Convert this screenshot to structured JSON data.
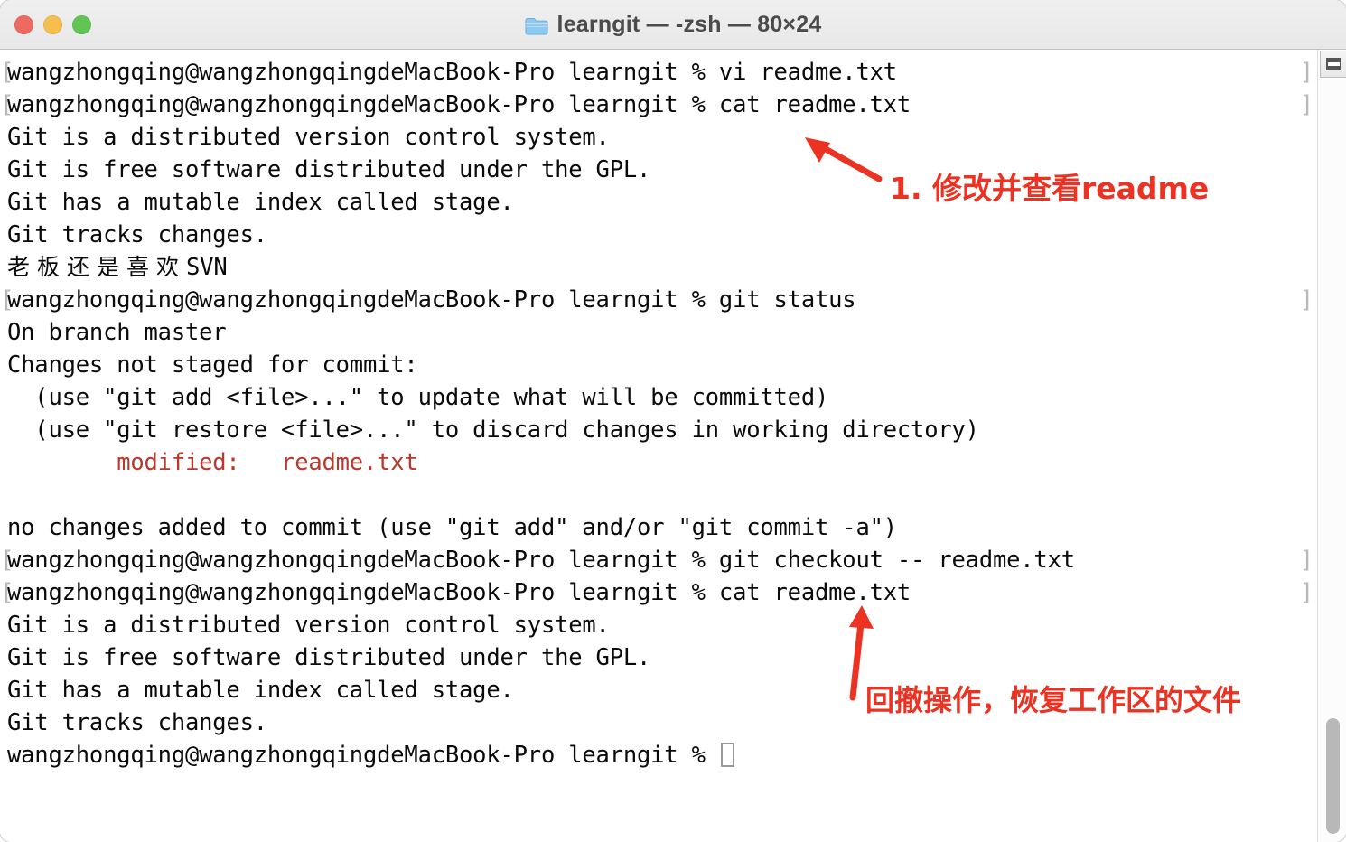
{
  "window": {
    "title": "learngit — -zsh — 80×24",
    "folder_icon": "folder-icon",
    "controls": {
      "close": "close-button",
      "minimize": "minimize-button",
      "zoom": "zoom-button"
    },
    "colors": {
      "close": "#ec6a5f",
      "minimize": "#f5bf4f",
      "zoom": "#61c555",
      "titlebar": "#ecebeb",
      "terminal_bg": "#ffffff",
      "terminal_fg": "#0a0a0a",
      "git_modified": "#b5392c",
      "annotation": "#eb3223"
    }
  },
  "terminal": {
    "prompt_prefix": "wangzhongqing@wangzhongqingdeMacBook-Pro learngit % ",
    "lines": [
      {
        "kind": "prompt",
        "text": "wangzhongqing@wangzhongqingdeMacBook-Pro learngit % vi readme.txt"
      },
      {
        "kind": "prompt",
        "text": "wangzhongqing@wangzhongqingdeMacBook-Pro learngit % cat readme.txt"
      },
      {
        "kind": "out",
        "text": "Git is a distributed version control system."
      },
      {
        "kind": "out",
        "text": "Git is free software distributed under the GPL."
      },
      {
        "kind": "out",
        "text": "Git has a mutable index called stage."
      },
      {
        "kind": "out",
        "text": "Git tracks changes."
      },
      {
        "kind": "cjk",
        "text": "老板还是喜欢",
        "suffix": "SVN"
      },
      {
        "kind": "prompt",
        "text": "wangzhongqing@wangzhongqingdeMacBook-Pro learngit % git status"
      },
      {
        "kind": "out",
        "text": "On branch master"
      },
      {
        "kind": "out",
        "text": "Changes not staged for commit:"
      },
      {
        "kind": "out",
        "text": "  (use \"git add <file>...\" to update what will be committed)"
      },
      {
        "kind": "out",
        "text": "  (use \"git restore <file>...\" to discard changes in working directory)"
      },
      {
        "kind": "red",
        "text": "        modified:   readme.txt"
      },
      {
        "kind": "out",
        "text": ""
      },
      {
        "kind": "out",
        "text": "no changes added to commit (use \"git add\" and/or \"git commit -a\")"
      },
      {
        "kind": "prompt",
        "text": "wangzhongqing@wangzhongqingdeMacBook-Pro learngit % git checkout -- readme.txt"
      },
      {
        "kind": "prompt",
        "text": "wangzhongqing@wangzhongqingdeMacBook-Pro learngit % cat readme.txt"
      },
      {
        "kind": "out",
        "text": "Git is a distributed version control system."
      },
      {
        "kind": "out",
        "text": "Git is free software distributed under the GPL."
      },
      {
        "kind": "out",
        "text": "Git has a mutable index called stage."
      },
      {
        "kind": "out",
        "text": "Git tracks changes."
      },
      {
        "kind": "cursorline",
        "text": "wangzhongqing@wangzhongqingdeMacBook-Pro learngit % "
      }
    ]
  },
  "scrollbar": {
    "pane_button": "split-pane-icon",
    "thumb": "scrollbar-thumb"
  },
  "annotations": [
    {
      "id": "annotation-1",
      "text": "1. 修改并查看readme",
      "arrow": "arrow-up-left"
    },
    {
      "id": "annotation-2",
      "text": "回撤操作，恢复工作区的文件",
      "arrow": "arrow-up"
    }
  ]
}
